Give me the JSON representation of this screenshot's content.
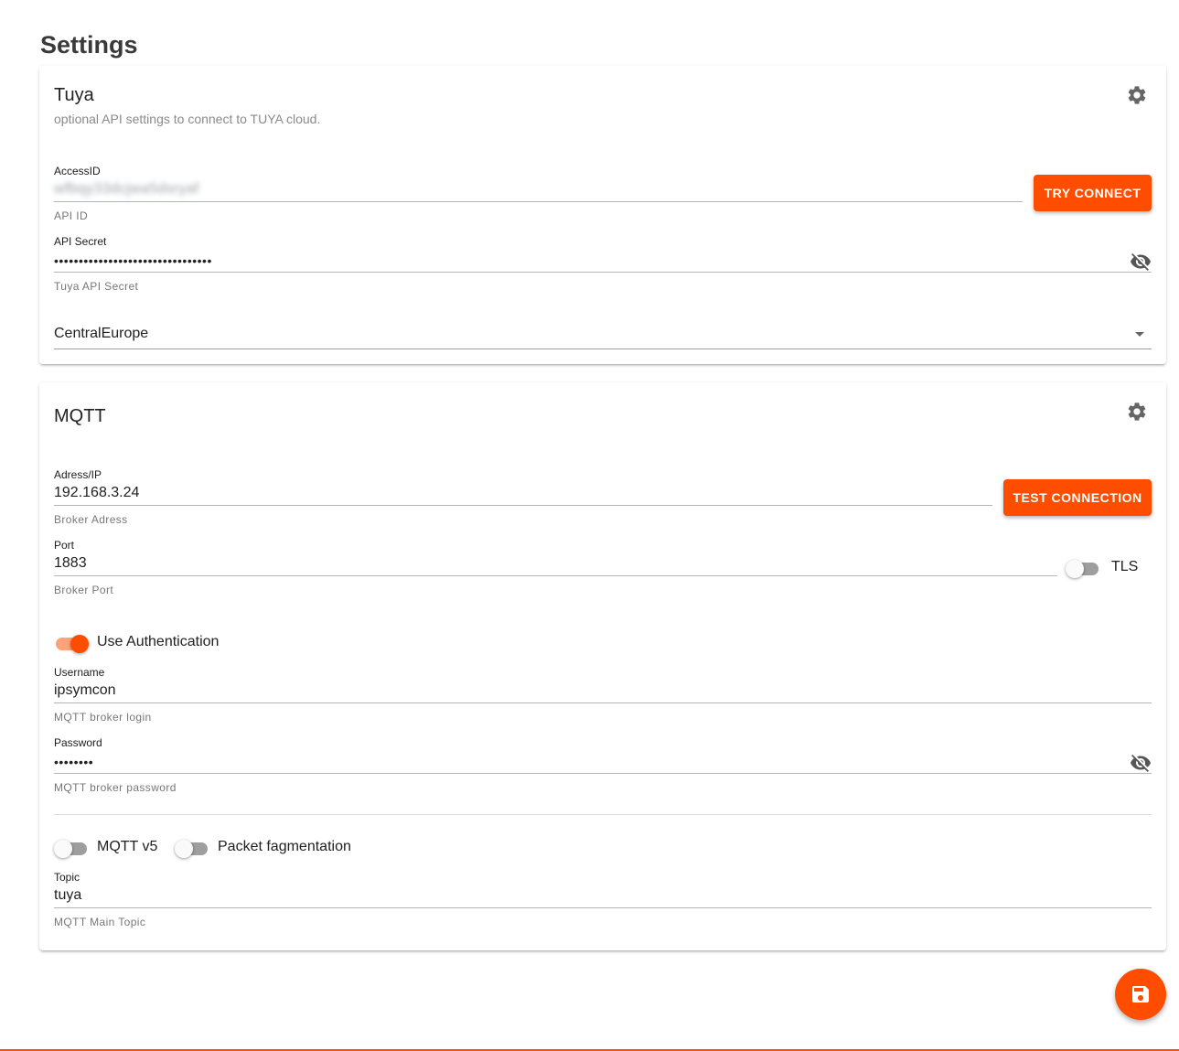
{
  "page": {
    "title": "Settings"
  },
  "colors": {
    "accent": "#ff4d00",
    "text": "#212121",
    "helper": "#777777"
  },
  "tuya": {
    "title": "Tuya",
    "subtitle": "optional API settings to connect to TUYA cloud.",
    "settings_icon": "gear-icon",
    "access_id": {
      "label": "AccessID",
      "value": "wfbqy33dcjwa5dsryaf",
      "helper": "API ID"
    },
    "try_connect_label": "TRY CONNECT",
    "api_secret": {
      "label": "API Secret",
      "value": "••••••••••••••••••••••••••••••••",
      "helper": "Tuya API Secret",
      "visibility_icon": "eye-off-icon"
    },
    "region": {
      "selected": "CentralEurope",
      "icon": "dropdown-arrow-icon"
    }
  },
  "mqtt": {
    "title": "MQTT",
    "settings_icon": "gear-icon",
    "address": {
      "label": "Adress/IP",
      "value": "192.168.3.24",
      "helper": "Broker Adress"
    },
    "test_connection_label": "TEST CONNECTION",
    "port": {
      "label": "Port",
      "value": "1883",
      "helper": "Broker Port"
    },
    "tls": {
      "label": "TLS",
      "on": false
    },
    "use_auth": {
      "label": "Use Authentication",
      "on": true
    },
    "username": {
      "label": "Username",
      "value": "ipsymcon",
      "helper": "MQTT broker login"
    },
    "password": {
      "label": "Password",
      "value": "••••••••",
      "helper": "MQTT broker password",
      "visibility_icon": "eye-off-icon"
    },
    "mqtt_v5": {
      "label": "MQTT v5",
      "on": false
    },
    "packet_frag": {
      "label": "Packet fagmentation",
      "on": false
    },
    "topic": {
      "label": "Topic",
      "value": "tuya",
      "helper": "MQTT Main Topic"
    }
  },
  "save": {
    "icon": "save-icon"
  }
}
